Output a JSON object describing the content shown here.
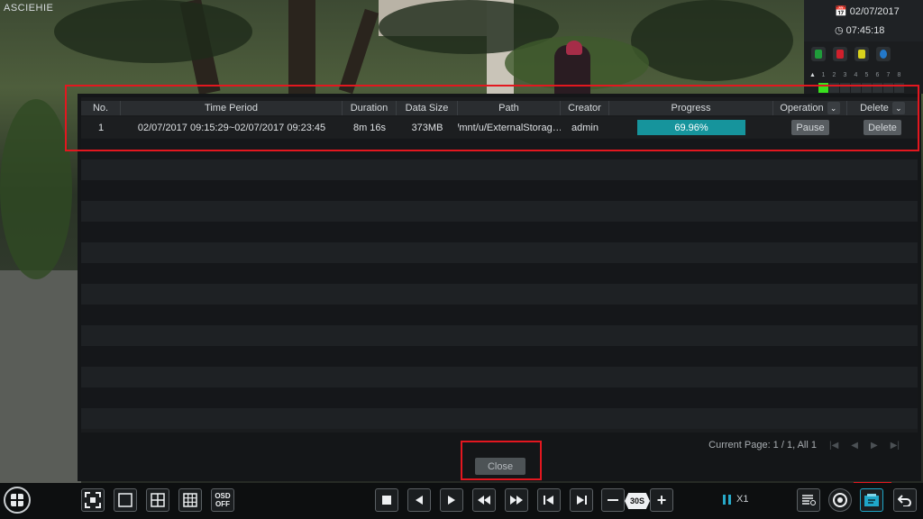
{
  "camera": {
    "title": "ASCIEHIE"
  },
  "datetime": {
    "date": "02/07/2017",
    "time": "07:45:18"
  },
  "channels": [
    "1",
    "2",
    "3",
    "4",
    "5",
    "6",
    "7",
    "8"
  ],
  "backup_table": {
    "columns": [
      "No.",
      "Time Period",
      "Duration",
      "Data Size",
      "Path",
      "Creator",
      "Progress",
      "Operation",
      "Delete"
    ],
    "rows": [
      {
        "no": "1",
        "time_period": "02/07/2017 09:15:29~02/07/2017 09:23:45",
        "duration": "8m 16s",
        "data_size": "373MB",
        "path": "/mnt/u/ExternalStorag…",
        "creator": "admin",
        "progress_label": "69.96%",
        "progress": 0.6996,
        "operation": "Pause",
        "delete": "Delete"
      }
    ],
    "pager": {
      "text": "Current Page: 1 / 1, All 1"
    }
  },
  "close_label": "Close",
  "toolbar": {
    "osd_on": "OSD",
    "osd_off": "OFF",
    "skip_label": "30S",
    "speed": "X1"
  },
  "colors": {
    "progress": "#16949c",
    "highlight": "#e3171f",
    "accent": "#27a9c9"
  }
}
